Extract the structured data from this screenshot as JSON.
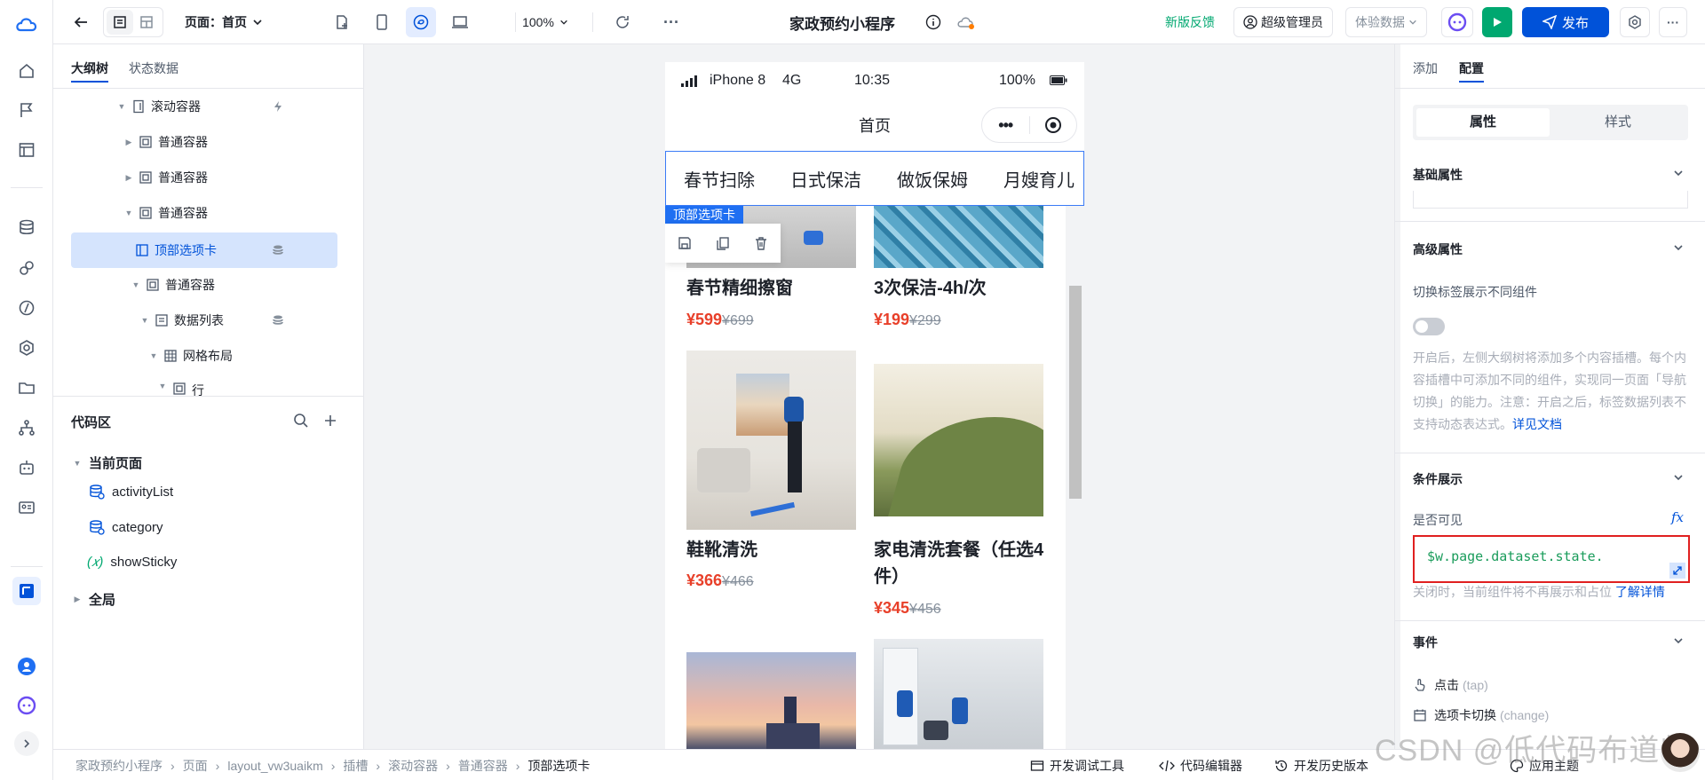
{
  "app": {
    "title": "家政预约小程序"
  },
  "topbar": {
    "page_selector": "页面：首页",
    "zoom": "100%",
    "feedback": "新版反馈",
    "admin": "超级管理员",
    "data_mode": "体验数据",
    "publish": "发布"
  },
  "outline": {
    "tabs": [
      "大纲树",
      "状态数据"
    ],
    "nodes": [
      "滚动容器",
      "普通容器",
      "普通容器",
      "普通容器",
      "顶部选项卡",
      "普通容器",
      "数据列表",
      "网格布局",
      "行"
    ]
  },
  "code": {
    "title": "代码区",
    "current_page": "当前页面",
    "items": [
      "activityList",
      "category",
      "showSticky"
    ],
    "global": "全局"
  },
  "phone": {
    "carrier": "iPhone 8",
    "network": "4G",
    "time": "10:35",
    "battery": "100%",
    "page_title": "首页",
    "tabs": [
      "春节扫除",
      "日式保洁",
      "做饭保姆",
      "月嫂育儿"
    ],
    "component_label": "顶部选项卡",
    "products": [
      {
        "name": "春节精细擦窗",
        "price": "¥599",
        "orig": "¥699"
      },
      {
        "name": "3次保洁-4h/次",
        "price": "¥199",
        "orig": "¥299"
      },
      {
        "name": "鞋靴清洗",
        "price": "¥366",
        "orig": "¥466"
      },
      {
        "name": "家电清洗套餐（任选4件）",
        "price": "¥345",
        "orig": "¥456"
      }
    ]
  },
  "right": {
    "tabs": [
      "添加",
      "配置"
    ],
    "seg": [
      "属性",
      "样式"
    ],
    "basic": "基础属性",
    "advanced": "高级属性",
    "toggle_label": "切换标签展示不同组件",
    "hint": "开启后，左侧大纲树将添加多个内容插槽。每个内容插槽中可添加不同的组件，实现同一页面「导航切换」的能力。注意：开启之后，标签数据列表不支持动态表达式。",
    "hint_link": "详见文档",
    "cond": "条件展示",
    "visible_label": "是否可见",
    "fx": "fx",
    "expr": "$w.page.dataset.state.",
    "close_hint": "关闭时，当前组件将不再展示和占位",
    "close_link": "了解详情",
    "events": "事件",
    "ev1": "点击",
    "ev1_code": "(tap)",
    "ev2": "选项卡切换",
    "ev2_code": "(change)"
  },
  "bottom": {
    "crumbs": [
      "家政预约小程序",
      "页面",
      "layout_vw3uaikm",
      "插槽",
      "滚动容器",
      "普通容器",
      "顶部选项卡"
    ],
    "debug": "开发调试工具",
    "editor": "代码编辑器",
    "history": "开发历史版本",
    "theme": "应用主题"
  },
  "watermark": "CSDN @低代码布道师"
}
